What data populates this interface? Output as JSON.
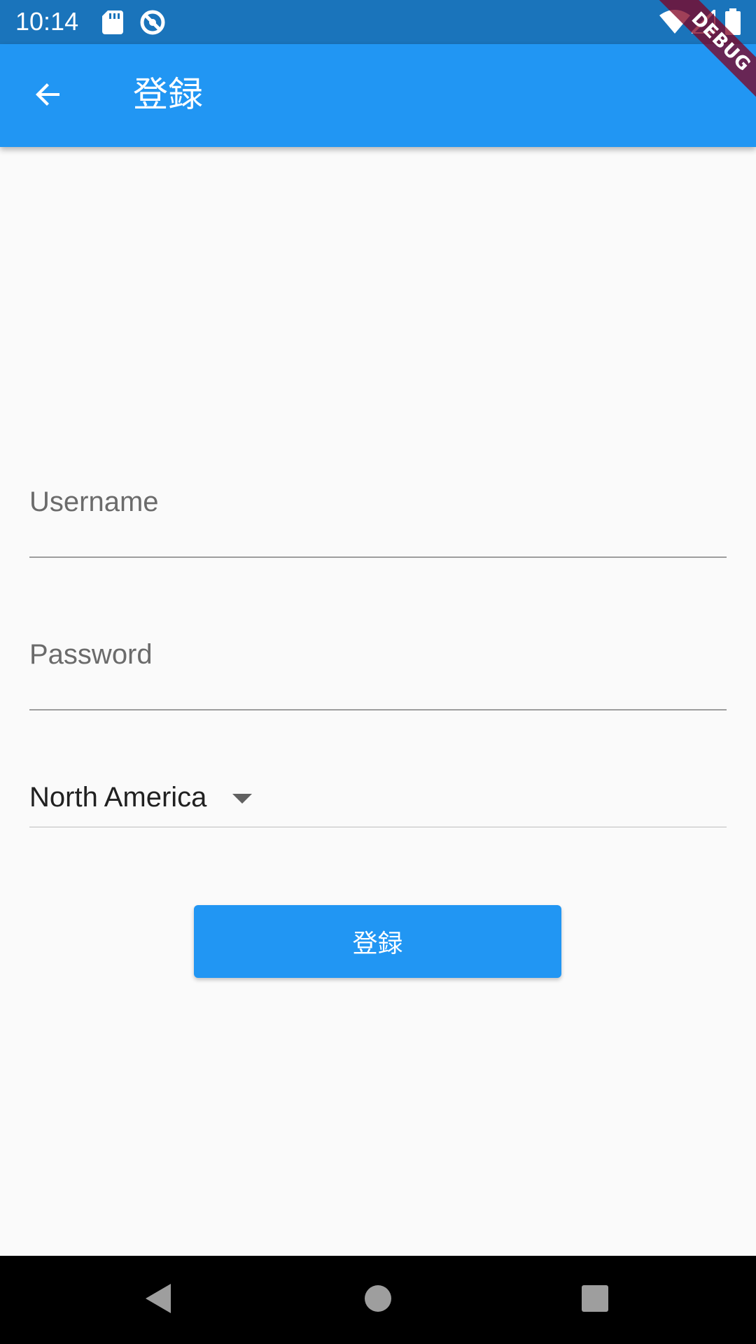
{
  "status_bar": {
    "time": "10:14",
    "icons": [
      "sd-card-icon",
      "no-sim-icon",
      "wifi-icon",
      "cell-signal-icon",
      "battery-icon"
    ],
    "bg_color": "#1A74BB"
  },
  "app_bar": {
    "back_icon": "arrow-back-icon",
    "title": "登録",
    "bg_color": "#2196F3"
  },
  "debug_banner": {
    "label": "DEBUG"
  },
  "form": {
    "username": {
      "label": "Username",
      "value": ""
    },
    "password": {
      "label": "Password",
      "value": ""
    },
    "region": {
      "selected": "North America",
      "arrow_icon": "dropdown-arrow-icon"
    },
    "submit_label": "登録"
  },
  "nav_bar": {
    "icons": [
      "back-triangle-icon",
      "home-circle-icon",
      "recents-square-icon"
    ]
  }
}
